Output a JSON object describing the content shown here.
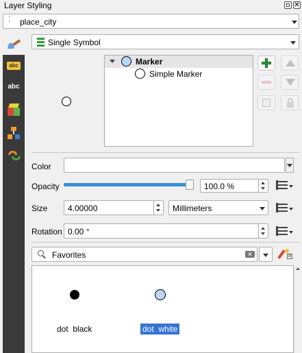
{
  "panel": {
    "title": "Layer Styling"
  },
  "layer_selector": {
    "value": "place_city"
  },
  "renderer_selector": {
    "value": "Single Symbol"
  },
  "symbol_tree": {
    "root": "Marker",
    "child": "Simple Marker"
  },
  "properties": {
    "color_label": "Color",
    "opacity_label": "Opacity",
    "opacity_value": "100.0 %",
    "opacity_fraction": 1.0,
    "size_label": "Size",
    "size_value": "4.00000",
    "size_unit": "Millimeters",
    "rotation_label": "Rotation",
    "rotation_value": "0.00 °"
  },
  "library": {
    "group_selector": "Favorites",
    "symbols": [
      {
        "label": "dot  black",
        "fill": "#000000",
        "selected": false
      },
      {
        "label": "dot  white",
        "fill": "#b9d6f5",
        "selected": true
      }
    ]
  },
  "colors": {
    "accent": "#3b8eda",
    "selection": "#3574d4",
    "marker_fill": "#b9d6f5"
  }
}
